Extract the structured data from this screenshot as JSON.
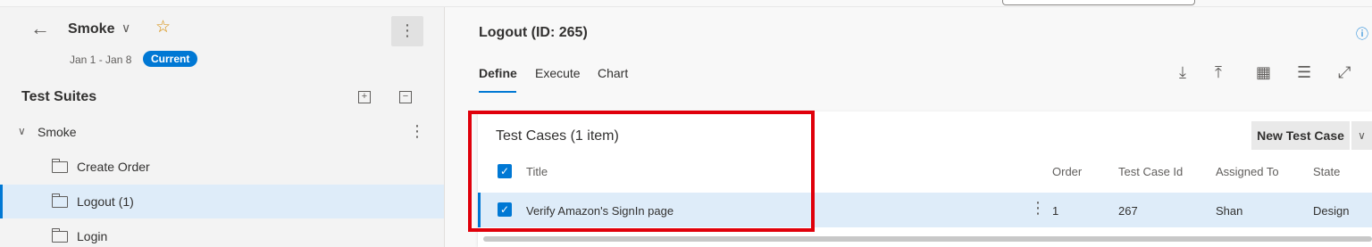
{
  "plan": {
    "name": "Smoke",
    "dates": "Jan 1 - Jan 8",
    "badge": "Current"
  },
  "suites": {
    "title": "Test Suites",
    "root": "Smoke",
    "items": [
      {
        "label": "Create Order",
        "selected": false
      },
      {
        "label": "Logout (1)",
        "selected": true
      },
      {
        "label": "Login",
        "selected": false
      }
    ]
  },
  "page": {
    "title": "Logout (ID: 265)",
    "tabs": [
      "Define",
      "Execute",
      "Chart"
    ],
    "active_tab": "Define"
  },
  "test_cases": {
    "title": "Test Cases (1 item)",
    "new_button": "New Test Case",
    "columns": [
      "Title",
      "Order",
      "Test Case Id",
      "Assigned To",
      "State"
    ],
    "rows": [
      {
        "title": "Verify Amazon's SignIn page",
        "order": "1",
        "id": "267",
        "assigned_to": "Shan",
        "state": "Design",
        "checked": true
      }
    ]
  },
  "colors": {
    "accent": "#0078d4",
    "selection": "#deecf9",
    "highlight": "#e0000b"
  }
}
